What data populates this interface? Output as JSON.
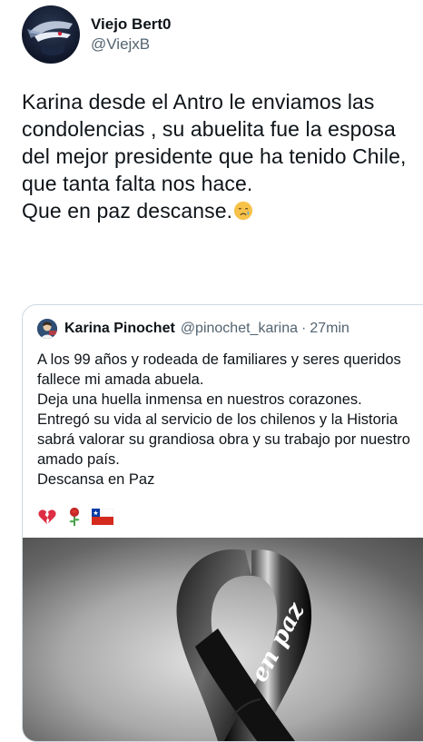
{
  "tweet": {
    "author": {
      "display_name": "Viejo Bert0",
      "handle": "@ViejxB",
      "avatar_icon": "masked-figure-avatar"
    },
    "text": "Karina desde el Antro le enviamos las condolencias , su abuelita fue la esposa del mejor presidente que ha tenido Chile, que tanta falta nos hace.\nQue en paz descanse.",
    "text_emoji": "crying-face-emoji"
  },
  "quoted_tweet": {
    "author": {
      "display_name": "Karina Pinochet",
      "handle": "@pinochet_karina",
      "separator": "·",
      "time": "27min",
      "avatar_icon": "profile-photo-avatar"
    },
    "text": "A los 99 años y rodeada de familiares y seres queridos fallece mi amada abuela.\nDeja una huella inmensa en nuestros corazones.\nEntregó su vida al servicio de los chilenos y la Historia sabrá valorar su grandiosa obra y su trabajo por nuestro amado país.\nDescansa en Paz",
    "emojis": [
      "broken-heart-emoji",
      "rose-emoji",
      "chile-flag-emoji"
    ],
    "media": {
      "description_icon": "black-mourning-ribbon-image",
      "ribbon_text": "en paz"
    }
  },
  "colors": {
    "text_primary": "#0f1419",
    "text_secondary": "#536471",
    "border": "#cfd9de",
    "background": "#ffffff"
  }
}
